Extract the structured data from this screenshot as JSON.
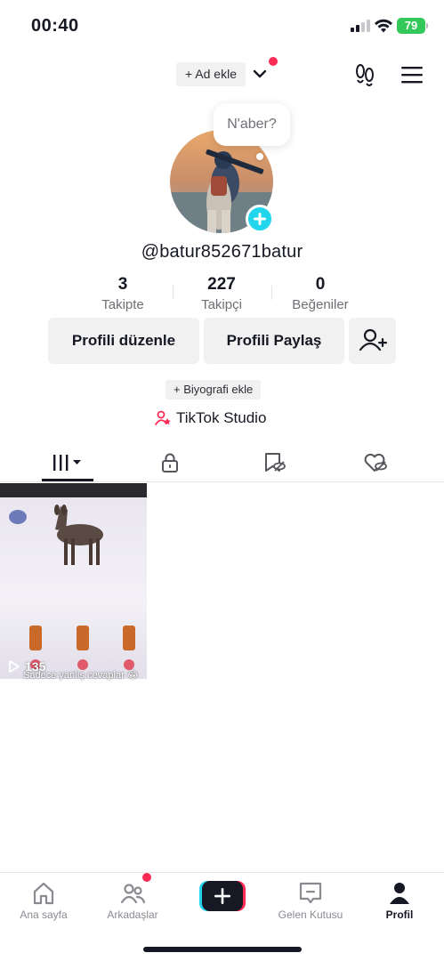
{
  "status": {
    "time": "00:40",
    "battery": "79"
  },
  "header": {
    "add_name_label": "+ Ad ekle"
  },
  "avatar": {
    "bubble_text": "N'aber?"
  },
  "profile": {
    "username": "@batur852671batur"
  },
  "stats": [
    {
      "value": "3",
      "label": "Takipte"
    },
    {
      "value": "227",
      "label": "Takipçi"
    },
    {
      "value": "0",
      "label": "Beğeniler"
    }
  ],
  "buttons": {
    "edit_profile": "Profili düzenle",
    "share_profile": "Profili Paylaş"
  },
  "bio": {
    "add_label": "+ Biyografi ekle"
  },
  "studio": {
    "label": "TikTok Studio"
  },
  "video": {
    "views": "135",
    "caption": "Sadece yanlış cevaplar 😂"
  },
  "nav": {
    "home": "Ana sayfa",
    "friends": "Arkadaşlar",
    "inbox": "Gelen Kutusu",
    "profile": "Profil"
  },
  "colors": {
    "accent": "#fe2c55",
    "cyan": "#20d5ec",
    "battery": "#34c759"
  }
}
